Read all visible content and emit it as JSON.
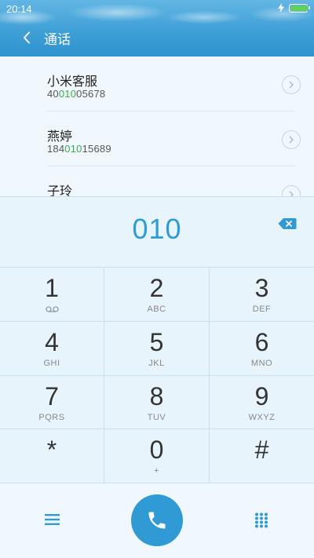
{
  "status_bar": {
    "time": "20:14",
    "battery_level": 1.0
  },
  "header": {
    "title": "通话"
  },
  "contacts": [
    {
      "name": "小米客服",
      "number_pre": "40",
      "number_match": "010",
      "number_post": "05678"
    },
    {
      "name": "燕婷",
      "number_pre": "184",
      "number_match": "010",
      "number_post": "15689"
    },
    {
      "name": "子玲",
      "number_pre": "",
      "number_match": "",
      "number_post": ""
    }
  ],
  "display": {
    "dialed": "010"
  },
  "keypad": [
    {
      "digit": "1",
      "letters": "",
      "icon": "voicemail-icon"
    },
    {
      "digit": "2",
      "letters": "ABC"
    },
    {
      "digit": "3",
      "letters": "DEF"
    },
    {
      "digit": "4",
      "letters": "GHI"
    },
    {
      "digit": "5",
      "letters": "JKL"
    },
    {
      "digit": "6",
      "letters": "MNO"
    },
    {
      "digit": "7",
      "letters": "PQRS"
    },
    {
      "digit": "8",
      "letters": "TUV"
    },
    {
      "digit": "9",
      "letters": "WXYZ"
    },
    {
      "digit": "*",
      "letters": ""
    },
    {
      "digit": "0",
      "letters": "+"
    },
    {
      "digit": "#",
      "letters": ""
    }
  ],
  "colors": {
    "accent": "#2f9ad4",
    "match": "#3aaa4d",
    "header": "#3f9fd6"
  },
  "icons": {
    "back": "back-chevron-icon",
    "backspace": "backspace-icon",
    "menu": "menu-icon",
    "call": "phone-icon",
    "dialpad": "dialpad-icon"
  }
}
